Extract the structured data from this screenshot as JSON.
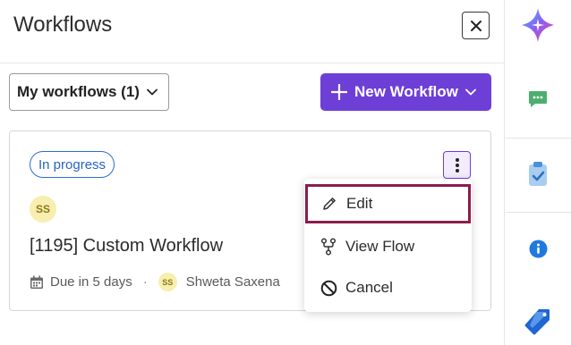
{
  "panel": {
    "title": "Workflows",
    "close_icon": "close-icon"
  },
  "toolbar": {
    "filter_label": "My workflows (1)",
    "new_button_label": "New Workflow",
    "accent_color": "#6e3fd6"
  },
  "card": {
    "status": "In progress",
    "avatar_initials": "SS",
    "title": "[1195] Custom Workflow",
    "due": "Due in 5 days",
    "separator": "·",
    "assignee_initials": "SS",
    "assignee_name": "Shweta Saxena"
  },
  "menu": {
    "items": [
      {
        "label": "Edit",
        "icon": "pencil-icon",
        "highlighted": true
      },
      {
        "label": "View Flow",
        "icon": "flow-icon",
        "highlighted": false
      },
      {
        "label": "Cancel",
        "icon": "ban-icon",
        "highlighted": false
      }
    ]
  },
  "rail": {
    "icons": [
      "sparkle-icon",
      "chat-icon",
      "clipboard-check-icon",
      "info-icon",
      "tag-icon"
    ]
  }
}
